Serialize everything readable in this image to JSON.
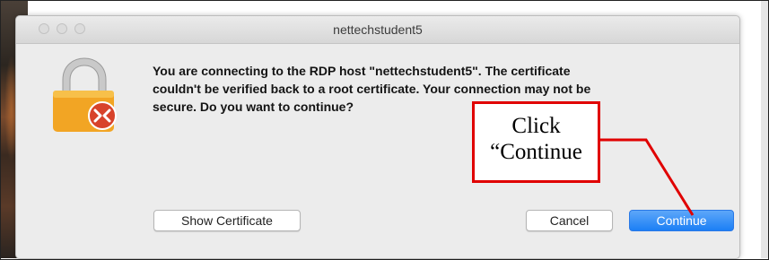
{
  "window": {
    "title": "nettechstudent5"
  },
  "dialog": {
    "message_lines": [
      "You are connecting to the RDP host \"nettechstudent5\". The certificate",
      "couldn't be verified back to a root certificate. Your connection may not be",
      "secure. Do you want to continue?"
    ]
  },
  "buttons": {
    "show_certificate": "Show Certificate",
    "cancel": "Cancel",
    "continue": "Continue"
  },
  "annotation": {
    "line1": "Click",
    "line2": "“Continue"
  },
  "icons": {
    "app_icon": "lock-with-remote-desktop-badge-icon"
  },
  "colors": {
    "accent_button": "#1b7ff5",
    "annotation_border": "#e00000",
    "lock_body": "#f2a524",
    "badge": "#d8432b"
  }
}
